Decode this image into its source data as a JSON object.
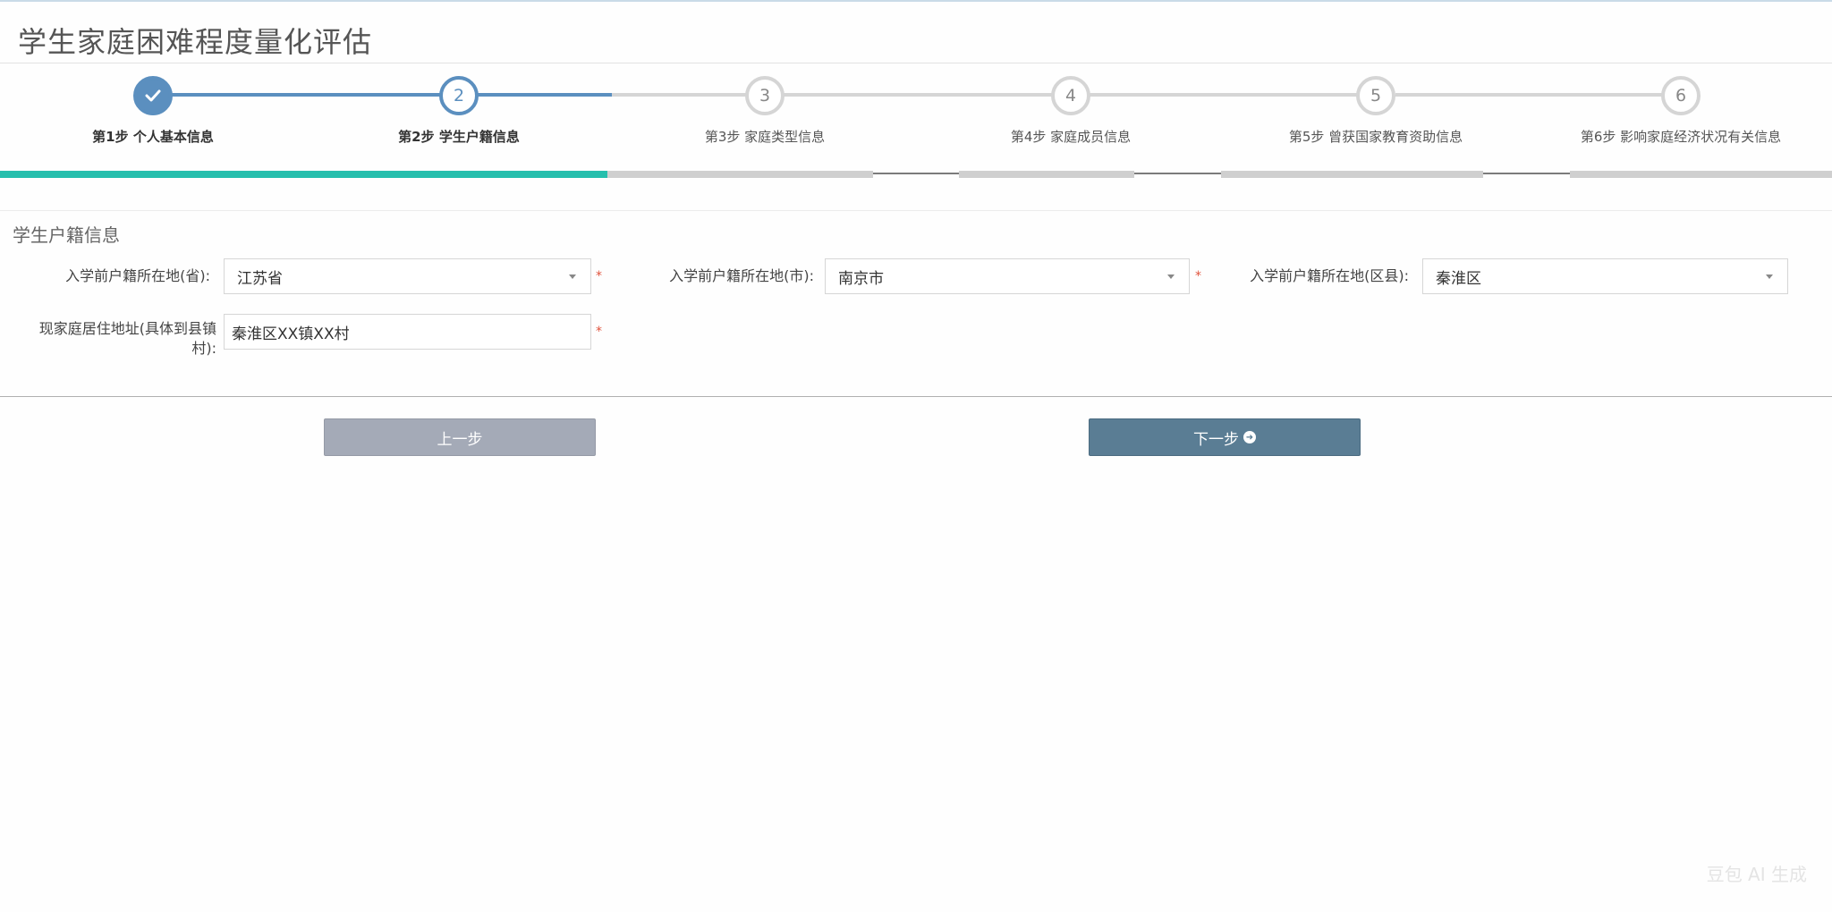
{
  "page": {
    "title": "学生家庭困难程度量化评估"
  },
  "wizard": {
    "steps": [
      {
        "number": "✓",
        "label": "第1步 个人基本信息",
        "status": "done"
      },
      {
        "number": "2",
        "label": "第2步 学生户籍信息",
        "status": "active"
      },
      {
        "number": "3",
        "label": "第3步 家庭类型信息",
        "status": "todo"
      },
      {
        "number": "4",
        "label": "第4步 家庭成员信息",
        "status": "todo"
      },
      {
        "number": "5",
        "label": "第5步 曾获国家教育资助信息",
        "status": "todo"
      },
      {
        "number": "6",
        "label": "第6步 影响家庭经济状况有关信息",
        "status": "todo"
      }
    ],
    "colors": {
      "accent": "#5b8fbf",
      "progress": "#26bfad",
      "inactive": "#d5d5d5"
    }
  },
  "form": {
    "section_title": "学生户籍信息",
    "province_label": "入学前户籍所在地(省):",
    "province_value": "江苏省",
    "city_label": "入学前户籍所在地(市):",
    "city_value": "南京市",
    "district_label": "入学前户籍所在地(区县):",
    "district_value": "秦淮区",
    "address_label_line1": "现家庭居住地址(具体到县镇",
    "address_label_line2": "村):",
    "address_value": "秦淮区XX镇XX村",
    "required_mark": "*"
  },
  "actions": {
    "prev_label": "上一步",
    "next_label": "下一步",
    "next_icon": "arrow-right-circle"
  },
  "watermark": "豆包 AI 生成"
}
